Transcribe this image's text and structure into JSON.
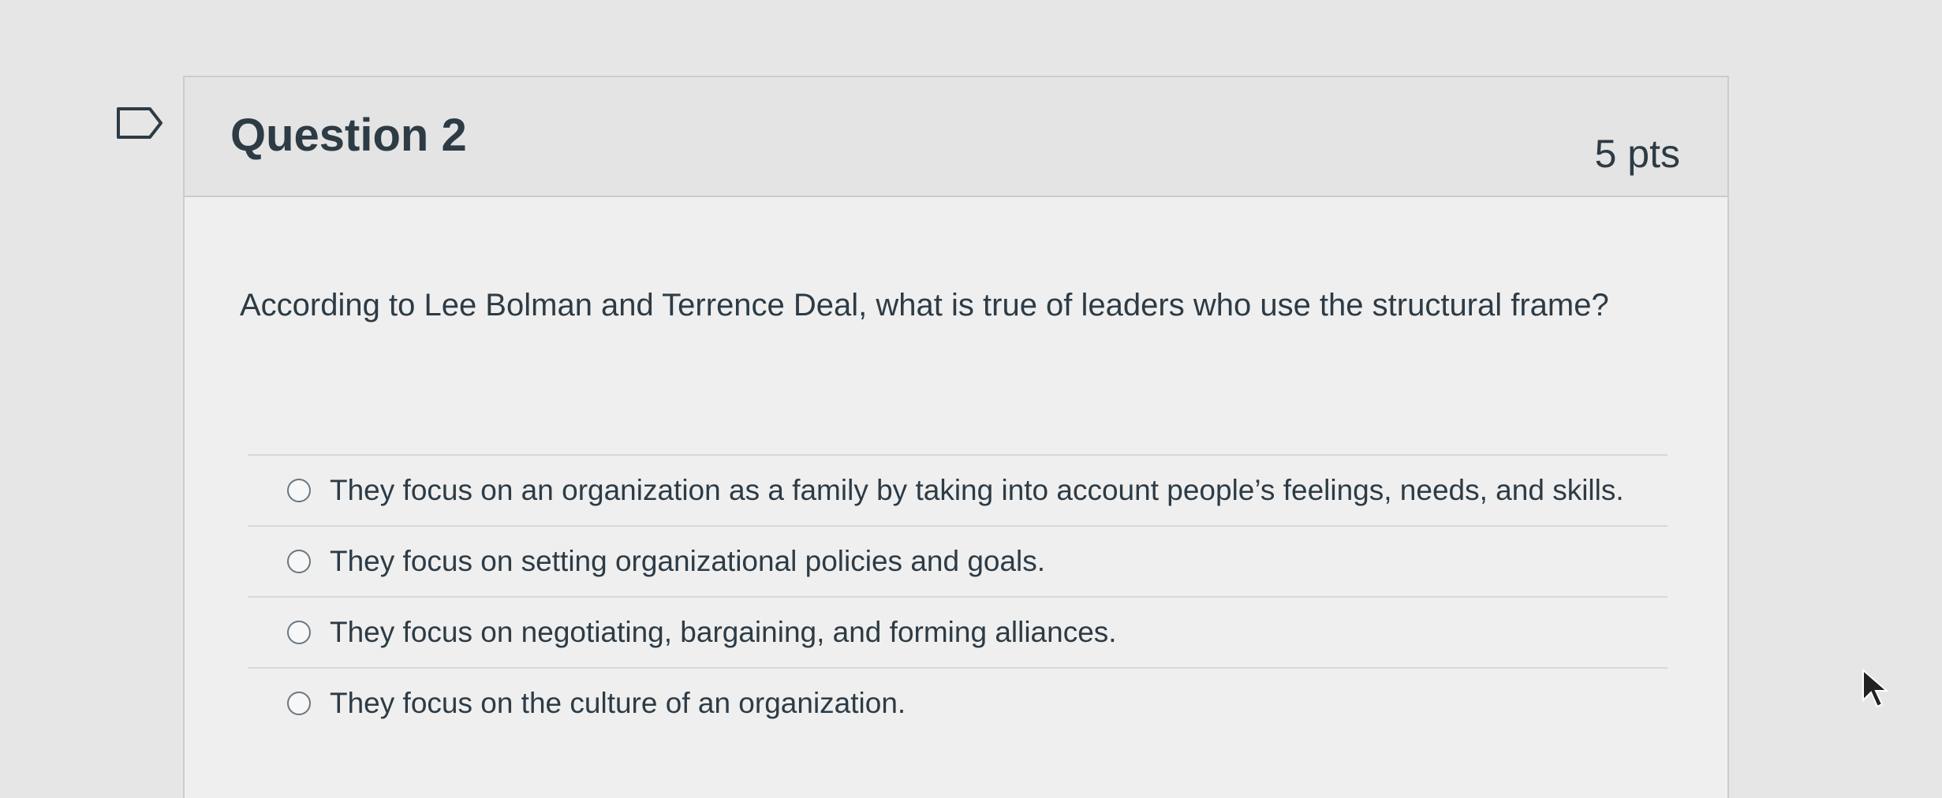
{
  "question": {
    "title": "Question 2",
    "points": "5 pts",
    "text": "According to Lee Bolman and Terrence Deal, what is true of leaders who use the structural frame?",
    "answers": [
      {
        "label": "They focus on an organization as a family by taking into account people’s feelings, needs, and skills.",
        "selected": false
      },
      {
        "label": "They focus on setting organizational policies and goals.",
        "selected": false
      },
      {
        "label": "They focus on negotiating, bargaining, and forming alliances.",
        "selected": false
      },
      {
        "label": "They focus on the culture of an organization.",
        "selected": false
      }
    ]
  },
  "icons": {
    "flag": "flag-question-icon",
    "radio": "radio-button-icon",
    "cursor": "mouse-pointer-icon"
  },
  "colors": {
    "text": "#2d3b45",
    "border": "#c7cdd1",
    "header_bg": "#e4e4e4"
  }
}
